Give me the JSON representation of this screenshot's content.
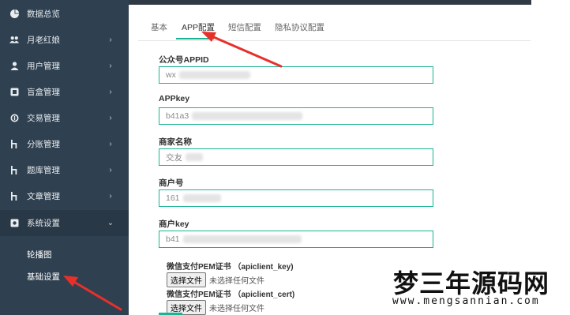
{
  "sidebar": {
    "items": [
      {
        "label": "数据总览",
        "icon": "pie-chart-icon",
        "has_arrow": false
      },
      {
        "label": "月老红娘",
        "icon": "users-icon",
        "has_arrow": true
      },
      {
        "label": "用户管理",
        "icon": "user-icon",
        "has_arrow": true
      },
      {
        "label": "盲盒管理",
        "icon": "box-icon",
        "has_arrow": true
      },
      {
        "label": "交易管理",
        "icon": "coin-icon",
        "has_arrow": true
      },
      {
        "label": "分账管理",
        "icon": "branch-icon",
        "has_arrow": true
      },
      {
        "label": "题库管理",
        "icon": "branch-icon",
        "has_arrow": true
      },
      {
        "label": "文章管理",
        "icon": "branch-icon",
        "has_arrow": true
      },
      {
        "label": "系统设置",
        "icon": "settings-icon",
        "has_arrow": true,
        "expanded": true
      }
    ],
    "sub_items": [
      {
        "label": "轮播图"
      },
      {
        "label": "基础设置"
      }
    ]
  },
  "tabs": [
    {
      "label": "基本",
      "active": false
    },
    {
      "label": "APP配置",
      "active": true
    },
    {
      "label": "短信配置",
      "active": false
    },
    {
      "label": "隐私协议配置",
      "active": false
    }
  ],
  "form": {
    "fields": [
      {
        "label": "公众号APPID",
        "value": "wx"
      },
      {
        "label": "APPkey",
        "value": "b41a3"
      },
      {
        "label": "商家名称",
        "value": "交友"
      },
      {
        "label": "商户号",
        "value": "161"
      },
      {
        "label": "商户key",
        "value": "b41"
      }
    ],
    "files": [
      {
        "label": "微信支付PEM证书 （apiclient_key)",
        "button": "选择文件",
        "status": "未选择任何文件"
      },
      {
        "label": "微信支付PEM证书 （apiclient_cert)",
        "button": "选择文件",
        "status": "未选择任何文件"
      }
    ]
  },
  "watermark": {
    "title": "梦三年源码网",
    "url": "www.mengsannian.com"
  },
  "colors": {
    "sidebar_bg": "#2f4050",
    "accent": "#1ab394",
    "annotation": "#e8302a"
  }
}
